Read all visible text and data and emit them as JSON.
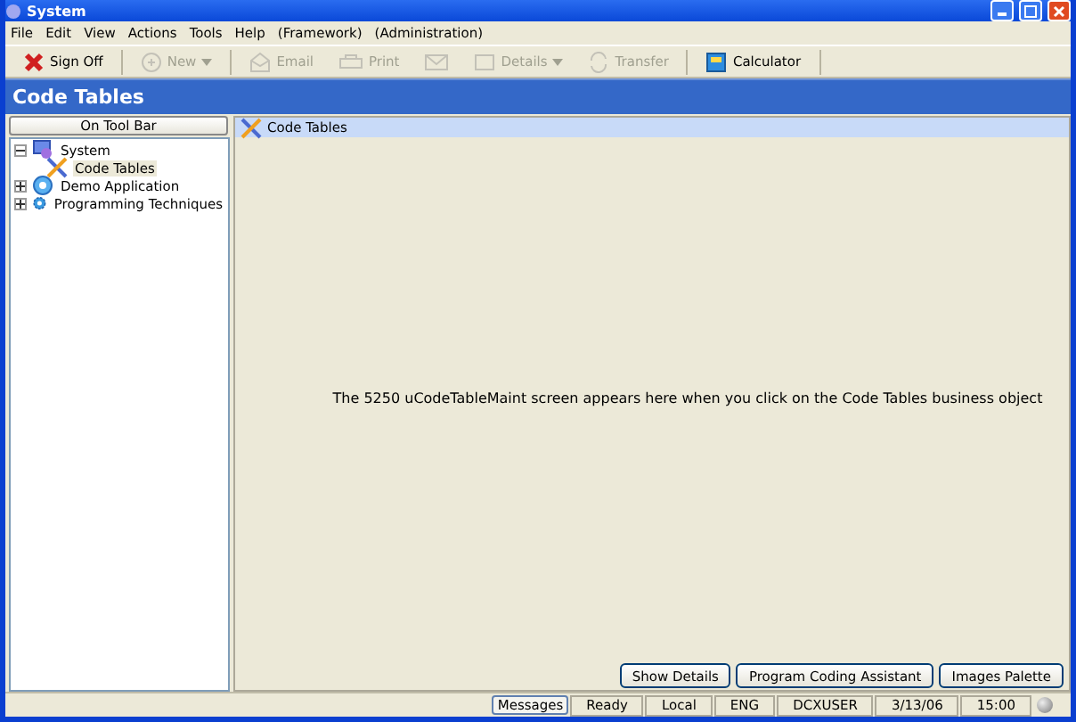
{
  "window": {
    "title": "System"
  },
  "menu": [
    "File",
    "Edit",
    "View",
    "Actions",
    "Tools",
    "Help",
    "(Framework)",
    "(Administration)"
  ],
  "toolbar": [
    {
      "kind": "signoff",
      "label": "Sign Off",
      "disabled": false
    },
    {
      "kind": "new",
      "label": "New",
      "disabled": true,
      "dropdown": true
    },
    {
      "kind": "email",
      "label": "Email",
      "disabled": true
    },
    {
      "kind": "print",
      "label": "Print",
      "disabled": true
    },
    {
      "kind": "envelope",
      "disabled": true
    },
    {
      "kind": "details",
      "label": "Details",
      "disabled": true,
      "dropdown": true
    },
    {
      "kind": "transfer",
      "label": "Transfer",
      "disabled": true
    },
    {
      "kind": "calculator",
      "label": "Calculator",
      "disabled": false
    }
  ],
  "header": "Code Tables",
  "sidebar": {
    "button": "On Tool Bar",
    "tree": [
      {
        "label": "System",
        "kind": "system",
        "expanded": true,
        "selected": false,
        "children": [
          {
            "label": "Code Tables",
            "kind": "tools",
            "selected": true
          }
        ]
      },
      {
        "label": "Demo Application",
        "kind": "app",
        "expanded": false,
        "selected": false
      },
      {
        "label": "Programming Techniques",
        "kind": "gear",
        "expanded": false,
        "selected": false
      }
    ]
  },
  "content": {
    "tab": "Code Tables",
    "message": "The 5250 uCodeTableMaint screen appears here when you click on the Code Tables business object",
    "buttons": [
      "Show Details",
      "Program Coding Assistant",
      "Images Palette"
    ]
  },
  "status_bar": [
    {
      "kind": "button",
      "text": "Messages"
    },
    {
      "kind": "panel",
      "text": "Ready"
    },
    {
      "kind": "panel",
      "text": "Local"
    },
    {
      "kind": "panel",
      "text": "ENG"
    },
    {
      "kind": "panel",
      "text": "DCXUSER"
    },
    {
      "kind": "panel",
      "text": "3/13/06"
    },
    {
      "kind": "panel",
      "text": "15:00"
    }
  ]
}
